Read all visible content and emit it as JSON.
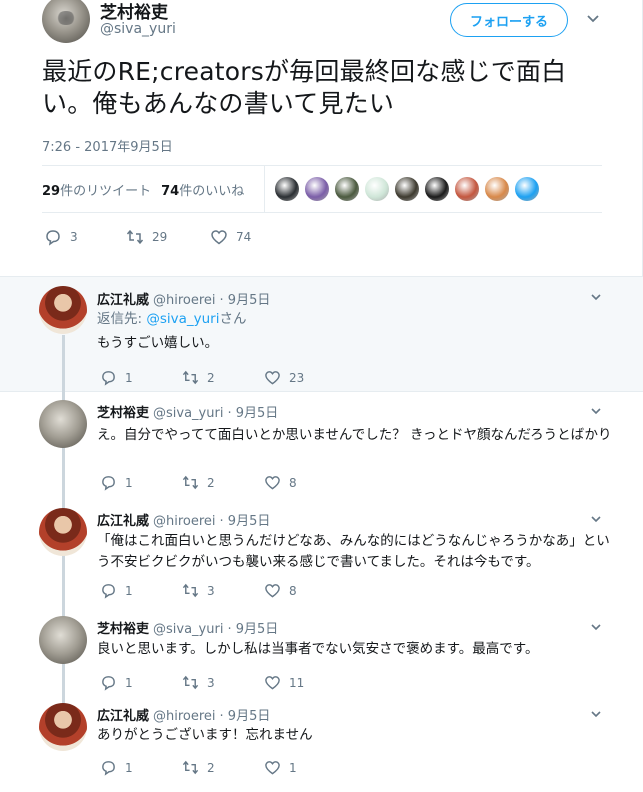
{
  "tweet": {
    "author_name": "芝村裕吏",
    "author_handle": "@siva_yuri",
    "follow_label": "フォローする",
    "text": "最近のRE;creatorsが毎回最終回な感じで面白い。俺もあんなの書いて見たい",
    "timestamp": "7:26 - 2017年9月5日",
    "retweet_count": "29",
    "retweet_label": "件のリツイート",
    "like_count": "74",
    "like_label": "件のいいね",
    "actions": {
      "reply": "3",
      "retweet": "29",
      "like": "74"
    }
  },
  "liker_colors": [
    "#2b2f33",
    "#7b5ea8",
    "#4b5a3f",
    "#cfe6d8",
    "#3d3a2f",
    "#1b1b1b",
    "#c4573f",
    "#d8894a",
    "#1da1f2"
  ],
  "replies": [
    {
      "name": "広江礼威",
      "handle": "@hiroerei",
      "date": "· 9月5日",
      "reply_to_label": "返信先: ",
      "reply_to_handle": "@siva_yuri",
      "reply_to_suffix": "さん",
      "text": "もうすごい嬉しい。",
      "reply": "1",
      "retweet": "2",
      "like": "23"
    },
    {
      "name": "芝村裕吏",
      "handle": "@siva_yuri",
      "date": "· 9月5日",
      "text": "え。自分でやってて面白いとか思いませんでした？ きっとドヤ顔なんだろうとばかり",
      "reply": "1",
      "retweet": "2",
      "like": "8"
    },
    {
      "name": "広江礼威",
      "handle": "@hiroerei",
      "date": "· 9月5日",
      "text": "「俺はこれ面白いと思うんだけどなあ、みんな的にはどうなんじゃろうかなあ」という不安ビクビクがいつも襲い来る感じで書いてました。それは今もです。",
      "reply": "1",
      "retweet": "3",
      "like": "8"
    },
    {
      "name": "芝村裕吏",
      "handle": "@siva_yuri",
      "date": "· 9月5日",
      "text": "良いと思います。しかし私は当事者でない気安さで褒めます。最高です。",
      "reply": "1",
      "retweet": "3",
      "like": "11"
    },
    {
      "name": "広江礼威",
      "handle": "@hiroerei",
      "date": "· 9月5日",
      "text": "ありがとうございます！忘れません",
      "reply": "1",
      "retweet": "2",
      "like": "1"
    }
  ]
}
